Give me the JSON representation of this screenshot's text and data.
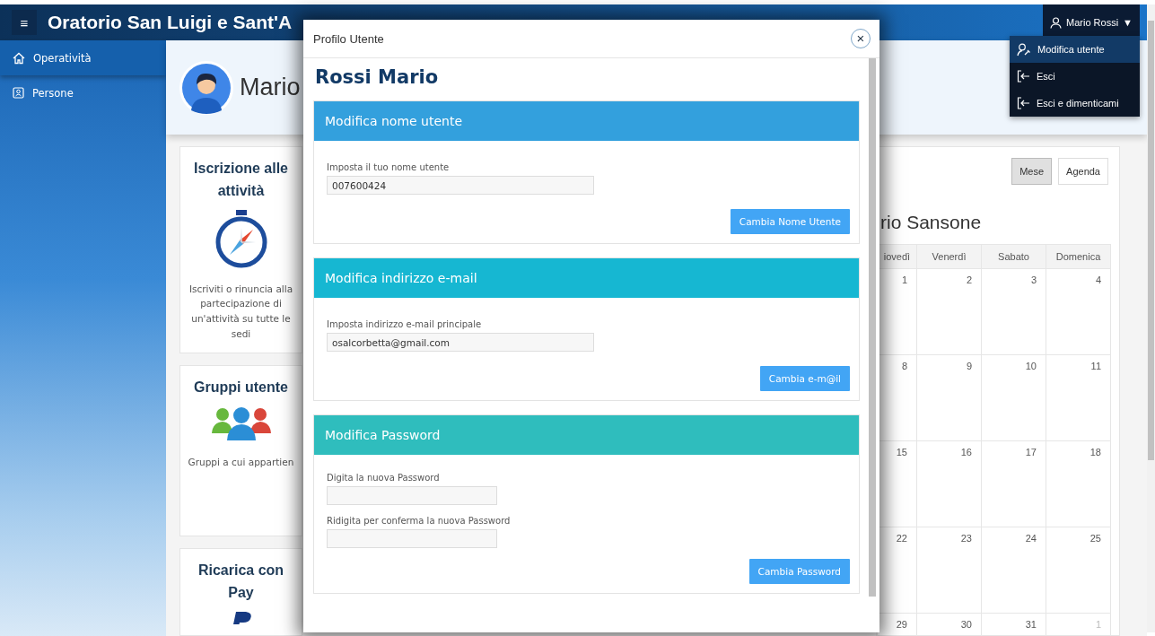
{
  "header": {
    "menu_glyph": "≡",
    "title": "Oratorio San Luigi e Sant'A"
  },
  "user_menu": {
    "label": "Mario Rossi",
    "caret": "▼",
    "items": [
      {
        "label": "Modifica utente",
        "selected": true
      },
      {
        "label": "Esci",
        "selected": false
      },
      {
        "label": "Esci e dimenticami",
        "selected": false
      }
    ]
  },
  "sidebar": {
    "items": [
      {
        "label": "Operatività",
        "selected": true
      },
      {
        "label": "Persone",
        "selected": false
      }
    ]
  },
  "profile_banner": {
    "name": "Mario"
  },
  "cards": [
    {
      "title": "Iscrizione alle attività",
      "text": "Iscriviti o rinuncia alla partecipazione di un'attività su tutte le sedi"
    },
    {
      "title": "Gruppi utente",
      "text": "Gruppi a cui appartien"
    },
    {
      "title": "Ricarica con Pay"
    }
  ],
  "calendar": {
    "views": [
      {
        "label": "Mese",
        "selected": true
      },
      {
        "label": "Agenda",
        "selected": false
      }
    ],
    "title": "rio Sansone",
    "columns": [
      "iovedì",
      "Venerdì",
      "Sabato",
      "Domenica"
    ],
    "weeks": [
      [
        {
          "day": "1",
          "other_month": false
        },
        {
          "day": "2",
          "other_month": false
        },
        {
          "day": "3",
          "other_month": false
        },
        {
          "day": "4",
          "other_month": false
        }
      ],
      [
        {
          "day": "8",
          "other_month": false
        },
        {
          "day": "9",
          "other_month": false
        },
        {
          "day": "10",
          "other_month": false
        },
        {
          "day": "11",
          "other_month": false
        }
      ],
      [
        {
          "day": "15",
          "other_month": false
        },
        {
          "day": "16",
          "other_month": false
        },
        {
          "day": "17",
          "other_month": false
        },
        {
          "day": "18",
          "other_month": false
        }
      ],
      [
        {
          "day": "22",
          "other_month": false
        },
        {
          "day": "23",
          "other_month": false
        },
        {
          "day": "24",
          "other_month": false
        },
        {
          "day": "25",
          "other_month": false
        }
      ],
      [
        {
          "day": "29",
          "other_month": false
        },
        {
          "day": "30",
          "other_month": false
        },
        {
          "day": "31",
          "other_month": false
        },
        {
          "day": "1",
          "other_month": true
        }
      ]
    ]
  },
  "modal": {
    "title": "Profilo Utente",
    "close_glyph": "×",
    "heading": "Rossi Mario",
    "sections": [
      {
        "title": "Modifica nome utente",
        "color": "#33a0dd",
        "fields": [
          {
            "kind": "text",
            "label": "Imposta il tuo nome utente",
            "value": "007600424"
          }
        ],
        "button": "Cambia Nome Utente"
      },
      {
        "title": "Modifica indirizzo e-mail",
        "color": "#16b7d2",
        "fields": [
          {
            "kind": "text",
            "label": "Imposta indirizzo e-mail principale",
            "value": "osalcorbetta@gmail.com"
          }
        ],
        "button": "Cambia e-m@il"
      },
      {
        "title": "Modifica Password",
        "color": "#2fbdbd",
        "fields": [
          {
            "kind": "password",
            "label": "Digita la nuova Password"
          },
          {
            "kind": "password",
            "label": "Ridigita per conferma la nuova Password"
          }
        ],
        "button": "Cambia Password"
      }
    ]
  }
}
